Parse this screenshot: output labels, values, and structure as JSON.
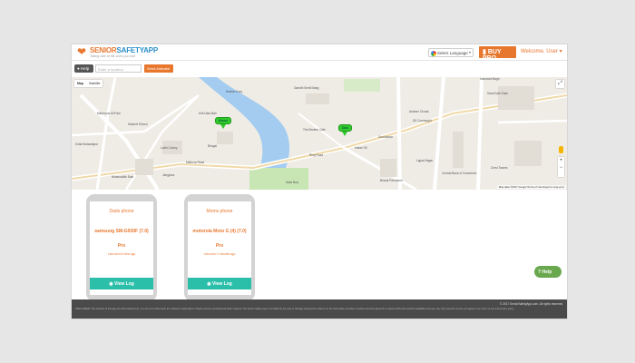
{
  "header": {
    "logo_left": "SENIOR",
    "logo_right": "SAFETYAPP",
    "tagline": "Taking care of the ones you love",
    "language": "Select Language",
    "buy_pro": "BUY PRO",
    "welcome": "Welcome, User"
  },
  "toolbar": {
    "help": "Help",
    "location_placeholder": "Enter a location",
    "send_button": "Send Airbrake"
  },
  "map": {
    "type_map": "Map",
    "type_satellite": "Satellite",
    "credit": "Map data ©2017 Google   Terms of Use   Report a map error",
    "markers": [
      "Moms",
      "Dad"
    ],
    "labels": [
      "Keshav Kunj",
      "Gandhi Smriti Marg",
      "Mahmood Ali Park",
      "Hatchet School",
      "Kirti Ulas Mall",
      "Kotla Mubarakpur",
      "Lodhi Colony",
      "Mathura Road",
      "Nizamuddin East",
      "The Modern Cafe",
      "Sabz Burj",
      "Indian Oil",
      "Ring Road",
      "Maharani Bagh",
      "Ashram Chowk",
      "IGI Connaught",
      "Bharat Petroleum",
      "Gurudwara",
      "Lajpat Nagar",
      "Sarai Kale Khan",
      "Jangpura",
      "Central Bank of Commerce",
      "Crest Towers",
      "Bhogal"
    ]
  },
  "devices": [
    {
      "name": "Dads phone",
      "model": "samsung SM-G930F (7.0)",
      "plan": "Pro",
      "last_seen": "Last seen 8 mins ago",
      "action": "View Log"
    },
    {
      "name": "Moms phone",
      "model": "motorola Moto G (4) (7.0)",
      "plan": "Pro",
      "last_seen": "Last seen 2 minutes ago",
      "action": "View Log"
    }
  ],
  "help_button": "Help",
  "footer": {
    "copyright": "© 2017 SeniorSafetyApp.com. All rights reserved.",
    "disclaimer": "DISCLAIMER: The contents of this app are informational only. It is not to be relied upon for medical or legal advice. Please consult a professional when required. The Senior Safety App is not liable for any loss or damage arising from reliance on the information provided. Location accuracy depends on device GPS and network availability and may vary. By using this service you agree to our terms of use and privacy policy."
  },
  "colors": {
    "accent": "#e8772e",
    "teal": "#2bbfaa",
    "help_green": "#6aa84f",
    "marker_green": "#32c82e",
    "water": "#a3ccf0",
    "footer": "#4a4a4a"
  }
}
